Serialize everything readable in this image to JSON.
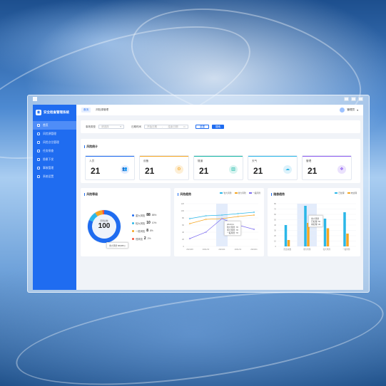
{
  "app": {
    "title": "安全检查管理系统"
  },
  "sidebar": {
    "items": [
      {
        "label": "首页",
        "active": true
      },
      {
        "label": "风险源管理"
      },
      {
        "label": "风险点位管理"
      },
      {
        "label": "任务排查"
      },
      {
        "label": "隐患下发"
      },
      {
        "label": "事故管理"
      },
      {
        "label": "系统设置"
      }
    ]
  },
  "tabs": [
    {
      "label": "首页",
      "active": true
    },
    {
      "label": "风险源管理"
    }
  ],
  "user": {
    "name": "管理员"
  },
  "filter": {
    "field1_label": "事故类型",
    "field1_placeholder": "请选择",
    "field2_label": "日期时间",
    "field2_start": "开始日期",
    "field2_end": "结束日期",
    "reset_label": "重置",
    "search_label": "搜索"
  },
  "stats": {
    "title": "风险统计",
    "items": [
      {
        "label": "人员",
        "value": "21",
        "color": "#1f6cf0",
        "icon": "users-icon"
      },
      {
        "label": "设备",
        "value": "21",
        "color": "#f5a623",
        "icon": "device-icon"
      },
      {
        "label": "隧道",
        "value": "21",
        "color": "#18b7a5",
        "icon": "tunnel-icon"
      },
      {
        "label": "天气",
        "value": "21",
        "color": "#2bb7e8",
        "icon": "weather-icon"
      },
      {
        "label": "管理",
        "value": "21",
        "color": "#8e5cf0",
        "icon": "manage-icon"
      }
    ]
  },
  "risk_level": {
    "title": "风险等级",
    "center_label": "风险总数",
    "total": "100",
    "levels": [
      {
        "label": "重大风险",
        "value": "88",
        "pct": "88%",
        "color": "#1f6cf0"
      },
      {
        "label": "较大风险",
        "value": "10",
        "pct": "10%",
        "color": "#2bb7e8"
      },
      {
        "label": "一般风险",
        "value": "8",
        "pct": "8%",
        "color": "#f5a623"
      },
      {
        "label": "低风险",
        "value": "2",
        "pct": "2%",
        "color": "#f5533d"
      }
    ],
    "tooltip": "重大风险  88(88%)"
  },
  "trend": {
    "title": "风险趋势",
    "tooltip": {
      "date": "2021/11",
      "rows": [
        "较大风险: 78",
        "重大风险: 78",
        "一般风险: 78"
      ]
    }
  },
  "hazard": {
    "title": "隐患趋势",
    "tooltip": {
      "title": "重大风险",
      "rows": [
        "已处理: 50",
        "未处理: 30"
      ]
    }
  },
  "chart_data": [
    {
      "type": "pie",
      "title": "风险等级",
      "categories": [
        "重大风险",
        "较大风险",
        "一般风险",
        "低风险"
      ],
      "values": [
        88,
        10,
        8,
        2
      ]
    },
    {
      "type": "line",
      "title": "风险趋势",
      "x": [
        "2021/09",
        "2021/10",
        "2021/11",
        "2021/12",
        "2022/01"
      ],
      "ylim": [
        0,
        120
      ],
      "yticks": [
        0,
        20,
        40,
        60,
        80,
        100,
        120
      ],
      "series": [
        {
          "name": "较大风险",
          "color": "#2bb7e8",
          "values": [
            78,
            86,
            88,
            92,
            96
          ]
        },
        {
          "name": "重大风险",
          "color": "#f5a623",
          "values": [
            64,
            76,
            78,
            84,
            88
          ]
        },
        {
          "name": "一般风险",
          "color": "#7c6cf0",
          "values": [
            22,
            40,
            78,
            60,
            48
          ]
        }
      ]
    },
    {
      "type": "bar",
      "title": "隐患趋势",
      "categories": [
        "隐患总数",
        "重大风险",
        "较大风险",
        "一般风险"
      ],
      "ylim": [
        0,
        80
      ],
      "yticks": [
        0,
        10,
        20,
        30,
        40,
        50,
        60,
        70,
        80
      ],
      "series": [
        {
          "name": "已处理",
          "color": "#2bb7e8",
          "values": [
            40,
            76,
            52,
            64
          ]
        },
        {
          "name": "未处理",
          "color": "#f5a623",
          "values": [
            12,
            44,
            34,
            24
          ]
        }
      ]
    }
  ]
}
